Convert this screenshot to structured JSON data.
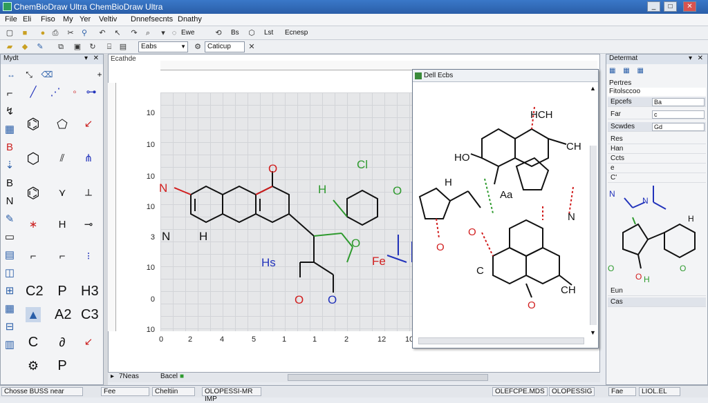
{
  "window": {
    "title": "ChemBioDraw Ultra   ChemBioDraw Ultra"
  },
  "menu": [
    "File",
    "Eli",
    "Fiso",
    "My",
    "Yer",
    "Veltiv",
    "Dnnefsecnts",
    "Dnathy"
  ],
  "toolbar2": {
    "style_combo": "Eabs",
    "font_combo": "Caticup"
  },
  "toolbar1": {
    "label_a": "Ewe",
    "label_b": "Bs",
    "label_c": "Lst",
    "label_d": "Ecnesp"
  },
  "tool_palette": {
    "title": "Mydt",
    "glyphs": [
      "C2",
      "P",
      "H3",
      "A2",
      "C3",
      "C",
      "P"
    ]
  },
  "document": {
    "ruler_label": "Ecathde",
    "y_labels": [
      "10",
      "10",
      "10",
      "10",
      "3",
      "10",
      "0",
      "10"
    ],
    "x_labels": [
      "0",
      "2",
      "4",
      "5",
      "1",
      "1",
      "2",
      "12",
      "10"
    ]
  },
  "popup": {
    "title": "Dell Ecbs"
  },
  "properties": {
    "title": "Determat",
    "tab1": "Pertres",
    "tab2": "Fitolsccoo",
    "rows": [
      {
        "label": "Epcefs",
        "value": "Ba"
      },
      {
        "label": "Far",
        "value": "c"
      },
      {
        "label": "Scwdes",
        "value": "Gd"
      },
      {
        "label": "Res",
        "value": ""
      },
      {
        "label": "Han",
        "value": ""
      },
      {
        "label": "Ccts",
        "value": ""
      },
      {
        "label": "e",
        "value": ""
      },
      {
        "label": "C'",
        "value": ""
      },
      {
        "label": "Eun",
        "value": ""
      },
      {
        "label": "Cas",
        "value": ""
      }
    ]
  },
  "bottom_tabs": [
    "7Neas",
    "Bacel"
  ],
  "status": {
    "left": "Chosse  BUSS near",
    "s1": "Fee",
    "s2": "Cheltiin",
    "s3": "OLOPESSI-MR IMP",
    "s4": "OLEFCPE.MDS",
    "s5": "OLOPESSIG",
    "s6": "Fae",
    "s7": "LIOL.EL"
  },
  "molecule_labels": {
    "main": [
      "N",
      "O",
      "N",
      "H",
      "O",
      "Cl",
      "H",
      "O",
      "Fe",
      "Hs",
      "O",
      "O"
    ],
    "popup": [
      "HCH",
      "HO",
      "CH",
      "H",
      "Aa",
      "N",
      "O",
      "CH",
      "C",
      "O",
      "O"
    ],
    "props": [
      "N",
      "N",
      "H",
      "O",
      "O",
      "H",
      "O",
      "O"
    ]
  },
  "colors": {
    "red": "#d11d1d",
    "green": "#2e9a2e",
    "blue": "#2233bb",
    "accent": "#2a5ea8"
  }
}
